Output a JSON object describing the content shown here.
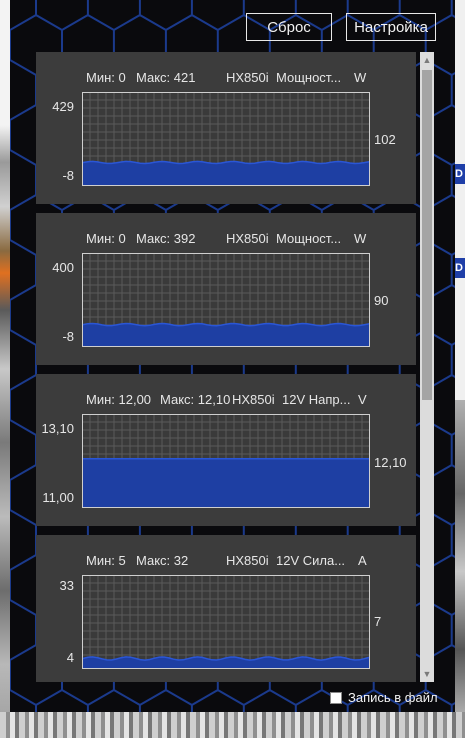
{
  "window": {
    "reset_button": "Сброс",
    "settings_button": "Настройка",
    "log_to_file_label": "Запись в файл",
    "log_to_file_checked": false
  },
  "background": {
    "right_tab_1": "D",
    "right_tab_2": "D"
  },
  "colors": {
    "window_bg": "#0a0a0d",
    "hex_stroke": "#1b3a8c",
    "panel_bg": "#3c3c3c",
    "plot_fill": "#1e3fa3",
    "plot_line": "#2a56d6",
    "grid": "#5a5a5a",
    "text": "#e6e6e6"
  },
  "panels": [
    {
      "min_label": "Мин: 0",
      "max_label": "Макс: 421",
      "device": "HX850i",
      "metric": "Мощност...",
      "unit": "W",
      "y_top": "429",
      "y_bottom": "-8",
      "current": "102",
      "chart_data": {
        "type": "area",
        "ylim": [
          -8,
          429
        ],
        "current_value": 102,
        "level_min": 94,
        "level_max": 104
      }
    },
    {
      "min_label": "Мин: 0",
      "max_label": "Макс: 392",
      "device": "HX850i",
      "metric": "Мощност...",
      "unit": "W",
      "y_top": "400",
      "y_bottom": "-8",
      "current": "90",
      "chart_data": {
        "type": "area",
        "ylim": [
          -8,
          400
        ],
        "current_value": 90,
        "level_min": 82,
        "level_max": 92
      }
    },
    {
      "min_label": "Мин: 12,00",
      "max_label": "Макс: 12,10",
      "device": "HX850i",
      "metric": "12V Напр...",
      "unit": "V",
      "y_top": "13,10",
      "y_bottom": "11,00",
      "current": "12,10",
      "chart_data": {
        "type": "area",
        "ylim": [
          11.0,
          13.1
        ],
        "current_value": 12.1,
        "level_min": 12.1,
        "level_max": 12.1
      }
    },
    {
      "min_label": "Мин: 5",
      "max_label": "Макс: 32",
      "device": "HX850i",
      "metric": "12V Сила...",
      "unit": "A",
      "y_top": "33",
      "y_bottom": "4",
      "current": "7",
      "chart_data": {
        "type": "area",
        "ylim": [
          4,
          33
        ],
        "current_value": 7,
        "level_min": 6.5,
        "level_max": 7.5
      }
    }
  ]
}
